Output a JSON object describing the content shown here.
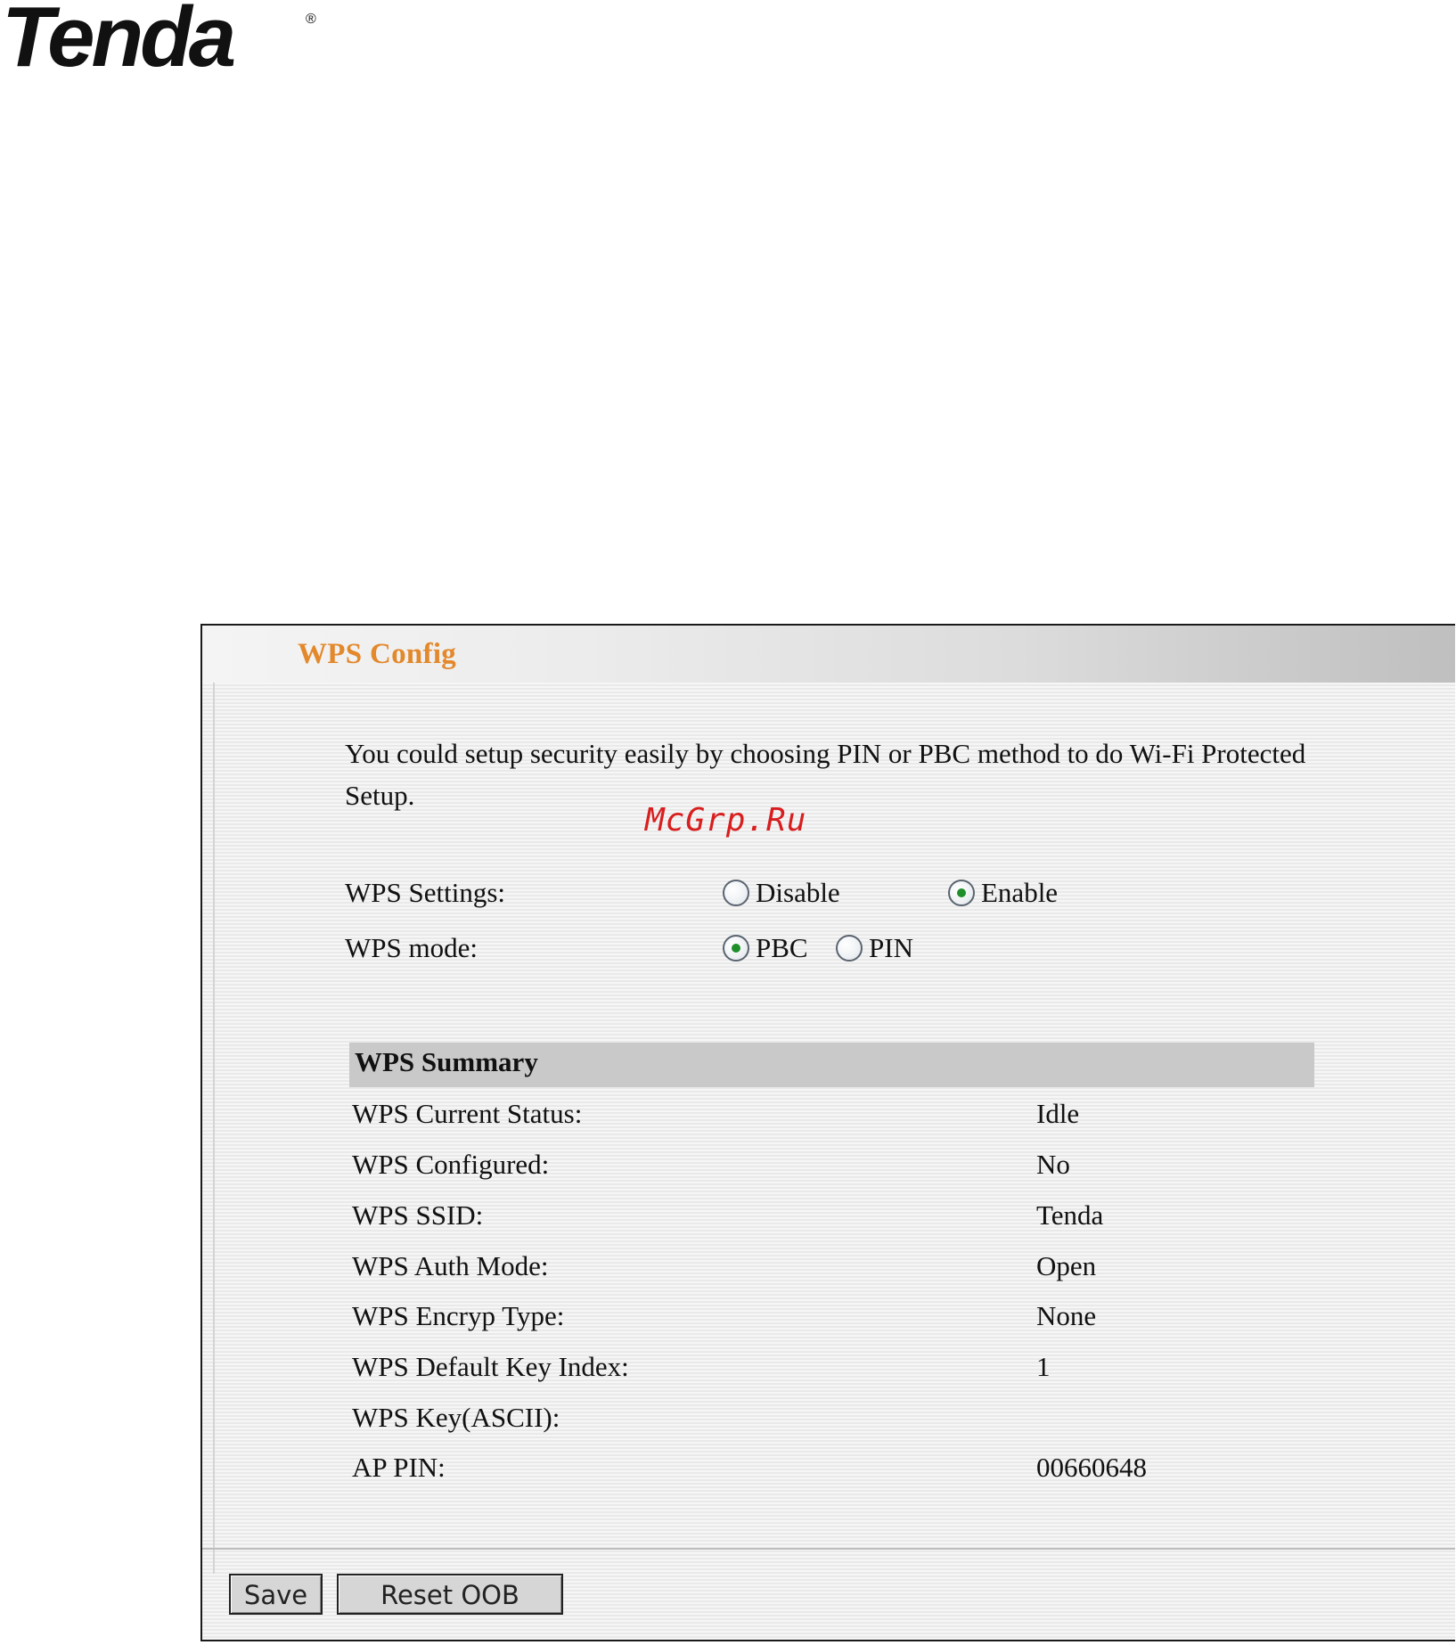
{
  "brand": {
    "name": "Tenda",
    "mark": "®"
  },
  "watermark": "McGrp.Ru",
  "panel": {
    "title": "WPS Config",
    "intro": "You could setup security easily by choosing PIN or PBC method to do Wi-Fi Protected Setup."
  },
  "settings": {
    "wps_settings": {
      "label": "WPS Settings:",
      "options": [
        {
          "label": "Disable",
          "checked": false
        },
        {
          "label": "Enable",
          "checked": true
        }
      ]
    },
    "wps_mode": {
      "label": "WPS mode:",
      "options": [
        {
          "label": "PBC",
          "checked": true
        },
        {
          "label": "PIN",
          "checked": false
        }
      ]
    }
  },
  "summary": {
    "title": "WPS Summary",
    "rows": [
      {
        "key": "WPS Current Status:",
        "value": "Idle"
      },
      {
        "key": "WPS Configured:",
        "value": "No"
      },
      {
        "key": "WPS SSID:",
        "value": "Tenda"
      },
      {
        "key": "WPS Auth Mode:",
        "value": "Open"
      },
      {
        "key": "WPS Encryp Type:",
        "value": "None"
      },
      {
        "key": "WPS Default Key Index:",
        "value": "1"
      },
      {
        "key": "WPS Key(ASCII):",
        "value": ""
      },
      {
        "key": "AP PIN:",
        "value": "00660648"
      }
    ]
  },
  "buttons": {
    "save": "Save",
    "reset": "Reset OOB"
  },
  "colors": {
    "title_orange": "#e3882b",
    "radio_dot_green": "#1f8f2a",
    "watermark_red": "#d81e1e"
  }
}
